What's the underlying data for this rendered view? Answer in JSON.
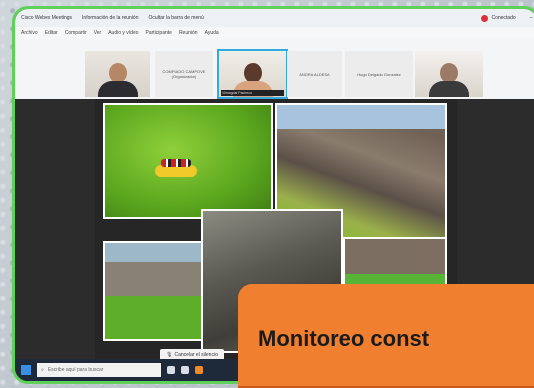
{
  "titlebar": {
    "app": "Cisco Webex Meetings",
    "info": "Información de la reunión",
    "hide_menu": "Ocultar la barra de menú",
    "recording": "Conectado"
  },
  "menubar": {
    "items": [
      "Archivo",
      "Editar",
      "Compartir",
      "Ver",
      "Audio y vídeo",
      "Participante",
      "Reunión",
      "Ayuda"
    ]
  },
  "participants": {
    "name1": "COMPIADO CAMPOVE",
    "name1_sub": "(Organizador)",
    "name2": "Vilmagdal Pacheco",
    "name3": "ANDRA ALDESA",
    "name4": "Hugo Delgado Gonzalez"
  },
  "share": {
    "stop_label": "Cancelar el silencio"
  },
  "taskbar": {
    "search_placeholder": "Escribe aquí para buscar"
  },
  "banner": {
    "text": "Monitoreo const",
    "color": "#f07f2f"
  }
}
